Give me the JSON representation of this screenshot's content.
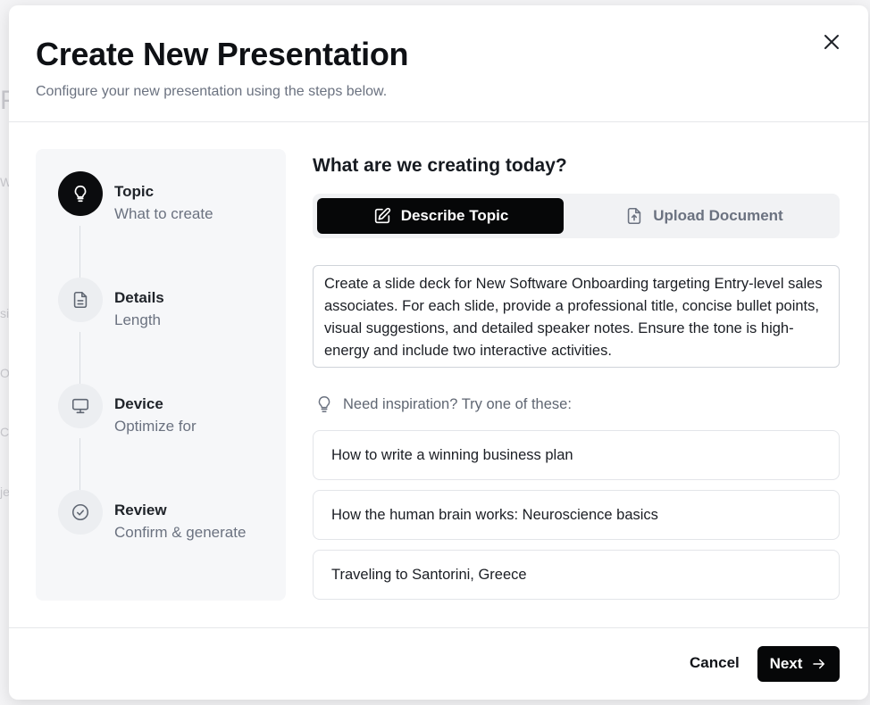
{
  "background": {
    "fragments": [
      "Pr",
      "W",
      "si",
      "O",
      "C",
      "je"
    ]
  },
  "modal": {
    "title": "Create New Presentation",
    "subtitle": "Configure your new presentation using the steps below.",
    "close_icon": "close-icon"
  },
  "steps": [
    {
      "title": "Topic",
      "desc": "What to create",
      "icon": "lightbulb-icon",
      "active": true
    },
    {
      "title": "Details",
      "desc": "Length",
      "icon": "document-icon",
      "active": false
    },
    {
      "title": "Device",
      "desc": "Optimize for",
      "icon": "monitor-icon",
      "active": false
    },
    {
      "title": "Review",
      "desc": "Confirm & generate",
      "icon": "check-circle-icon",
      "active": false
    }
  ],
  "panel": {
    "title": "What are we creating today?",
    "tabs": [
      {
        "label": "Describe Topic",
        "icon": "edit-icon",
        "active": true
      },
      {
        "label": "Upload Document",
        "icon": "upload-file-icon",
        "active": false
      }
    ],
    "prompt_text": "Create a slide deck for New Software Onboarding targeting Entry-level sales associates. For each slide, provide a professional title, concise bullet points, visual suggestions, and detailed speaker notes. Ensure the tone is high-energy and include two interactive activities.",
    "inspiration_label": "Need inspiration? Try one of these:",
    "suggestions": [
      "How to write a winning business plan",
      "How the human brain works: Neuroscience basics",
      "Traveling to Santorini, Greece"
    ]
  },
  "footer": {
    "cancel_label": "Cancel",
    "next_label": "Next",
    "next_icon": "arrow-right-icon"
  },
  "colors": {
    "primary": "#060708",
    "muted_text": "#6b7280",
    "stepper_bg": "#f6f7f9",
    "border": "#cfd3d9"
  }
}
